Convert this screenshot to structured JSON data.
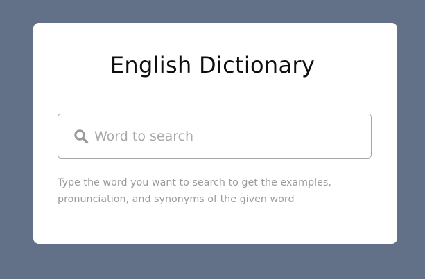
{
  "colors": {
    "page_background": "#637188",
    "card_background": "#ffffff",
    "title_color": "#0e0e0e",
    "placeholder_color": "#a9a9a9",
    "hint_color": "#9b9b9b",
    "input_border": "#a6a6a6",
    "icon_color": "#9a9a9a"
  },
  "card": {
    "title": "English Dictionary",
    "search": {
      "icon": "search-icon",
      "placeholder": "Word to search",
      "value": ""
    },
    "hint_text": "Type the word you want to search to get the examples, pronunciation, and synonyms of the given word"
  }
}
